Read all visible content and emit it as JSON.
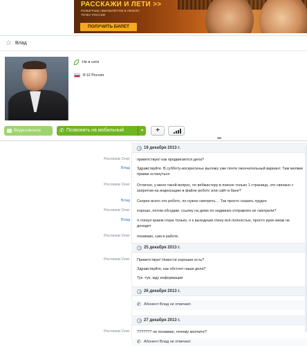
{
  "banner": {
    "title": "РАССКАЖИ И ЛЕТИ >>",
    "subtitle": "РОЗЫГРЫШ АВИАБИЛЕТОВ В ЛЮБУЮ ТОЧКУ РОССИИ",
    "button": "ПОЛУЧИТЬ БИЛЕТ"
  },
  "header": {
    "contact_name": "Влад"
  },
  "profile": {
    "status": "Не в сети",
    "location": "8:12 Россия"
  },
  "actions": {
    "video_call": "Видеозвонок",
    "call_mobile": "Позвонить на мобильный",
    "call_caret": "▾",
    "add": "+"
  },
  "chat": {
    "dates": [
      "19 декабря 2013 г.",
      "25 декабря 2013 г.",
      "26 декабря 2013 г.",
      "27 декабря 2013 г."
    ],
    "messages": [
      {
        "author": "Росляков Олег",
        "text": "приветствую! как продвигаются дела?"
      },
      {
        "author": "Влад",
        "text": "Здравствуйте. В субботу-воскресенье выложу уже почти окончательный вариант. Там мелкие правки остануться"
      },
      {
        "author": "Росляков Олег",
        "text": "Отлично, у меня такой вопрос, по вебмастеру в поиске только 1 страница, это связано с запретом на индексацию в файле роботс или сайт в бане?"
      },
      {
        "author": "Влад",
        "text": "Скорее всего это роботс, по нужно смотреть… Так просто сказать трудно"
      },
      {
        "author": "Росляков Олег",
        "text": "хорошо, потом обсудим. ссылку на демо  по недвинке отправлял не смотрели?"
      },
      {
        "author": "Влад",
        "text": "я глянул краем глаза только, я к выходным гляну всё полностью, просто руки никак не доходят"
      },
      {
        "author": "Росляков Олег",
        "text": "понимаю, сам в работе."
      },
      {
        "author": "Росляков Олег",
        "text": "Приветствую! Новости хорошие есть?"
      },
      {
        "author": "",
        "text": "Здравствуйте, как обстоят наши дела?"
      },
      {
        "author": "",
        "text": "Тук -тук, жду информации"
      },
      {
        "author": "Росляков Олег",
        "text": "??????? не понимаю, почему молчите?"
      }
    ],
    "events": [
      "Абонент Влад не отвечает.",
      "Абонент Влад не отвечает."
    ]
  },
  "colors": {
    "call_green": "#6fb523",
    "video_green": "#9fd36f",
    "self_author_blue": "#2f78c4",
    "other_author_gray": "#7d8790"
  },
  "icons": [
    "star-icon",
    "leaf-icon",
    "flag-icon",
    "video-icon",
    "phone-icon",
    "signal-icon",
    "clock-icon"
  ]
}
